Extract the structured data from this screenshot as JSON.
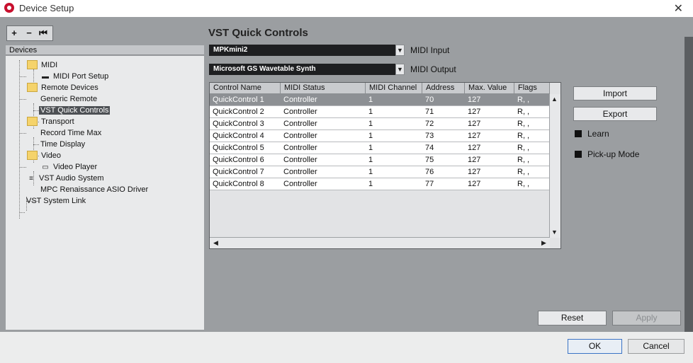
{
  "window": {
    "title": "Device Setup",
    "icon": "cubase-icon"
  },
  "toolbar": {
    "add": "+",
    "remove": "−",
    "reset": "⏮"
  },
  "devices": {
    "header": "Devices",
    "items": [
      {
        "label": "MIDI",
        "icon": "folder-icon"
      },
      {
        "label": "MIDI Port Setup",
        "icon": "midi-port-icon"
      },
      {
        "label": "Remote Devices",
        "icon": "folder-icon"
      },
      {
        "label": "Generic Remote"
      },
      {
        "label": "VST Quick Controls",
        "selected": true
      },
      {
        "label": "Transport",
        "icon": "folder-icon"
      },
      {
        "label": "Record Time Max"
      },
      {
        "label": "Time Display"
      },
      {
        "label": "Video",
        "icon": "folder-icon"
      },
      {
        "label": "Video Player",
        "icon": "video-icon"
      },
      {
        "label": "VST Audio System",
        "icon": "audio-system-icon"
      },
      {
        "label": "MPC Renaissance ASIO Driver"
      },
      {
        "label": "VST System Link"
      }
    ]
  },
  "panel": {
    "title": "VST Quick Controls",
    "midi_input": {
      "value": "MPKmini2",
      "label": "MIDI Input"
    },
    "midi_output": {
      "value": "Microsoft GS Wavetable Synth",
      "label": "MIDI Output"
    }
  },
  "table": {
    "columns": [
      "Control Name",
      "MIDI Status",
      "MIDI Channel",
      "Address",
      "Max. Value",
      "Flags"
    ],
    "rows": [
      [
        "QuickControl 1",
        "Controller",
        "1",
        "70",
        "127",
        "R, ,"
      ],
      [
        "QuickControl 2",
        "Controller",
        "1",
        "71",
        "127",
        "R, ,"
      ],
      [
        "QuickControl 3",
        "Controller",
        "1",
        "72",
        "127",
        "R, ,"
      ],
      [
        "QuickControl 4",
        "Controller",
        "1",
        "73",
        "127",
        "R, ,"
      ],
      [
        "QuickControl 5",
        "Controller",
        "1",
        "74",
        "127",
        "R, ,"
      ],
      [
        "QuickControl 6",
        "Controller",
        "1",
        "75",
        "127",
        "R, ,"
      ],
      [
        "QuickControl 7",
        "Controller",
        "1",
        "76",
        "127",
        "R, ,"
      ],
      [
        "QuickControl 8",
        "Controller",
        "1",
        "77",
        "127",
        "R, ,"
      ]
    ]
  },
  "side": {
    "import": "Import",
    "export": "Export",
    "learn": "Learn",
    "pickup": "Pick-up Mode"
  },
  "actions": {
    "reset": "Reset",
    "apply": "Apply",
    "ok": "OK",
    "cancel": "Cancel"
  }
}
